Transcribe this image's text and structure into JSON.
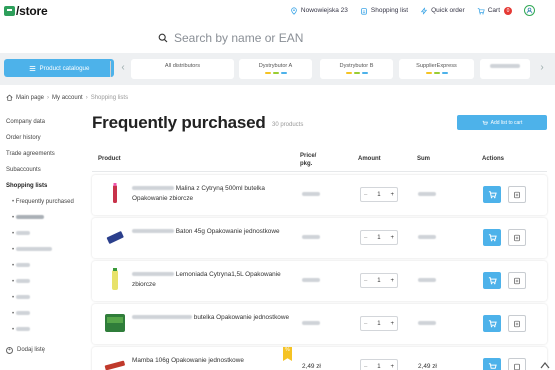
{
  "header": {
    "logo_text": "/store",
    "location": "Nowowiejska 23",
    "shopping_list": "Shopping list",
    "quick_order": "Quick order",
    "cart_label": "Cart",
    "cart_count": "0",
    "search_placeholder": "Search by name or EAN"
  },
  "distributors": {
    "catalog_button": "Product catalogue",
    "items": [
      "All distributors",
      "Dystrybutor A",
      "Dystrybutor B",
      "SupplierExpress"
    ]
  },
  "breadcrumb": {
    "items": [
      "Main page",
      "My account",
      "Shopping lists"
    ]
  },
  "sidebar": {
    "items": [
      "Company data",
      "Order history",
      "Trade agreements",
      "Subaccounts"
    ],
    "section": "Shopping lists",
    "sublists": [
      "Frequently purchased"
    ],
    "add_list": "Dodaj listę"
  },
  "main": {
    "title": "Frequently purchased",
    "count": "30 products",
    "add_list_to_cart": "Add list to cart"
  },
  "table": {
    "headers": {
      "product": "Product",
      "price": "Price/ pkg.",
      "amount": "Amount",
      "sum": "Sum",
      "actions": "Actions"
    },
    "rows": [
      {
        "name": "Malina z Cytryną 500ml butelka Opakowanie zbiorcze",
        "price": "",
        "amount": "1",
        "sum": "",
        "promo": false
      },
      {
        "name": "Baton 45g Opakowanie jednostkowe",
        "price": "",
        "amount": "1",
        "sum": "",
        "promo": false
      },
      {
        "name": "Lemoniada Cytryna1,5L Opakowanie zbiorcze",
        "price": "",
        "amount": "1",
        "sum": "",
        "promo": false
      },
      {
        "name": "butelka Opakowanie jednostkowe",
        "price": "",
        "amount": "1",
        "sum": "",
        "promo": false
      },
      {
        "name": "Mamba 106g Opakowanie jednostkowe",
        "price": "2,49 zł",
        "amount": "1",
        "sum": "2,49 zł",
        "promo": true,
        "promo_icon": "%"
      }
    ]
  },
  "colors": {
    "accent": "#4db2ea",
    "brand_green": "#2e9f5b",
    "badge_red": "#e53935",
    "promo_yellow": "#f5c324",
    "distributor_bar": "#eef0f2"
  }
}
